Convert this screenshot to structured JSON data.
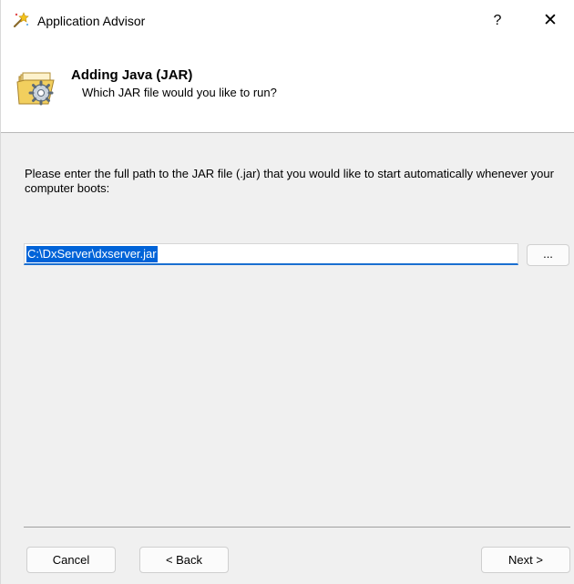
{
  "window": {
    "title": "Application Advisor",
    "help_label": "?",
    "close_label": "✕",
    "title_icon": "magic-wand-icon"
  },
  "header": {
    "title": "Adding Java (JAR)",
    "subtitle": "Which JAR file would you like to run?",
    "icon": "folder-gear-icon"
  },
  "main": {
    "instruction": "Please enter the full path to the JAR file (.jar) that you would like to start automatically whenever your computer boots:",
    "path_value": "C:\\DxServer\\dxserver.jar",
    "browse_label": "..."
  },
  "footer": {
    "cancel_label": "Cancel",
    "back_label": "< Back",
    "next_label": "Next >"
  },
  "colors": {
    "accent": "#0063d8",
    "background": "#f0f0f0"
  }
}
